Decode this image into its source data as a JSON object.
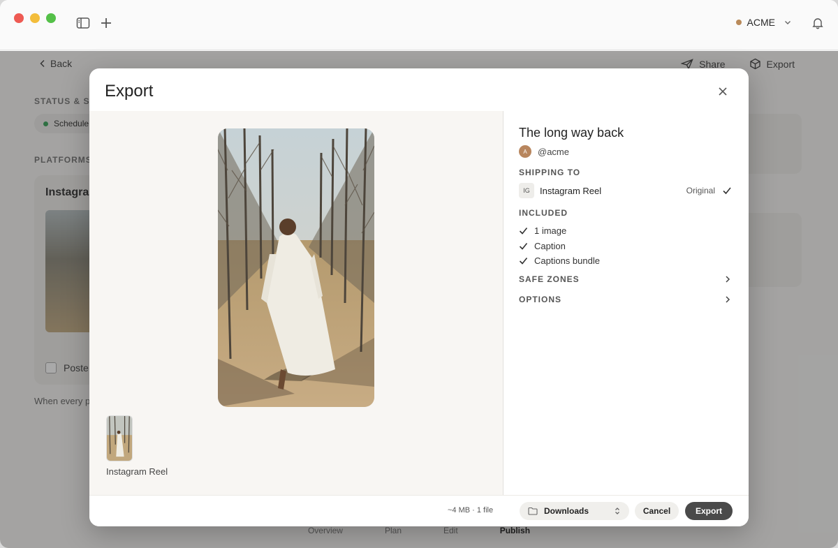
{
  "titlebar": {
    "workspace": "ACME"
  },
  "page": {
    "back_label": "Back",
    "share_label": "Share",
    "export_label": "Export",
    "status_section": "STATUS & SC",
    "status_value": "Schedule",
    "platforms_section": "PLATFORMS",
    "platform_card_title": "Instagra",
    "posted_label": "Poste",
    "when_text": "When every p",
    "tabs": [
      "Overview",
      "Plan",
      "Edit",
      "Publish"
    ],
    "active_tab": "Publish"
  },
  "modal": {
    "title": "Export",
    "preview": {
      "variant_label": "Instagram Reel"
    },
    "details": {
      "post_title": "The long way back",
      "avatar_initial": "A",
      "handle": "@acme",
      "shipping_label": "SHIPPING TO",
      "shipping": {
        "badge": "IG",
        "name": "Instagram Reel",
        "format": "Original"
      },
      "included_label": "INCLUDED",
      "included": [
        "1 image",
        "Caption",
        "Captions bundle"
      ],
      "safe_zones_label": "SAFE ZONES",
      "options_label": "OPTIONS"
    },
    "footer": {
      "info": "~4 MB · 1 file",
      "destination": "Downloads",
      "cancel_label": "Cancel",
      "export_label": "Export"
    }
  }
}
